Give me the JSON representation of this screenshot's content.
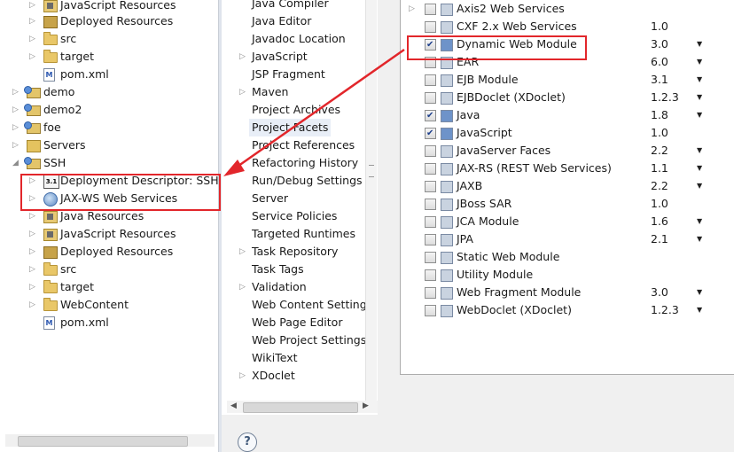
{
  "project_tree": {
    "items": [
      {
        "label": "JavaScript Resources",
        "icon": "js-resources-icon"
      },
      {
        "label": "Deployed Resources",
        "icon": "deployed-resources-icon"
      },
      {
        "label": "src",
        "icon": "folder-icon"
      },
      {
        "label": "target",
        "icon": "folder-icon"
      },
      {
        "label": "pom.xml",
        "icon": "maven-file-icon"
      },
      {
        "label": "demo",
        "icon": "project-icon"
      },
      {
        "label": "demo2",
        "icon": "project-icon"
      },
      {
        "label": "foe",
        "icon": "project-icon"
      },
      {
        "label": "Servers",
        "icon": "servers-folder-icon"
      },
      {
        "label": "SSH",
        "icon": "project-icon"
      },
      {
        "label": "Deployment Descriptor: SSH",
        "icon": "deployment-descriptor-icon"
      },
      {
        "label": "JAX-WS Web Services",
        "icon": "web-services-icon"
      },
      {
        "label": "Java Resources",
        "icon": "java-resources-icon"
      },
      {
        "label": "JavaScript Resources",
        "icon": "js-resources-icon"
      },
      {
        "label": "Deployed Resources",
        "icon": "deployed-resources-icon"
      },
      {
        "label": "src",
        "icon": "folder-icon"
      },
      {
        "label": "target",
        "icon": "folder-icon"
      },
      {
        "label": "WebContent",
        "icon": "folder-icon"
      },
      {
        "label": "pom.xml",
        "icon": "maven-file-icon"
      }
    ]
  },
  "properties_nav": {
    "items": [
      {
        "label": "Java Compiler"
      },
      {
        "label": "Java Editor"
      },
      {
        "label": "Javadoc Location"
      },
      {
        "label": "JavaScript"
      },
      {
        "label": "JSP Fragment"
      },
      {
        "label": "Maven"
      },
      {
        "label": "Project Archives"
      },
      {
        "label": "Project Facets"
      },
      {
        "label": "Project References"
      },
      {
        "label": "Refactoring History"
      },
      {
        "label": "Run/Debug Settings"
      },
      {
        "label": "Server"
      },
      {
        "label": "Service Policies"
      },
      {
        "label": "Targeted Runtimes"
      },
      {
        "label": "Task Repository"
      },
      {
        "label": "Task Tags"
      },
      {
        "label": "Validation"
      },
      {
        "label": "Web Content Settings"
      },
      {
        "label": "Web Page Editor"
      },
      {
        "label": "Web Project Settings"
      },
      {
        "label": "WikiText"
      },
      {
        "label": "XDoclet"
      }
    ],
    "selected": "Project Facets"
  },
  "facets": {
    "rows": [
      {
        "name": "Axis2 Web Services",
        "version": "",
        "checked": false,
        "has_dropdown": false
      },
      {
        "name": "CXF 2.x Web Services",
        "version": "1.0",
        "checked": false,
        "has_dropdown": false
      },
      {
        "name": "Dynamic Web Module",
        "version": "3.0",
        "checked": true,
        "has_dropdown": true
      },
      {
        "name": "EAR",
        "version": "6.0",
        "checked": false,
        "has_dropdown": true
      },
      {
        "name": "EJB Module",
        "version": "3.1",
        "checked": false,
        "has_dropdown": true
      },
      {
        "name": "EJBDoclet (XDoclet)",
        "version": "1.2.3",
        "checked": false,
        "has_dropdown": true
      },
      {
        "name": "Java",
        "version": "1.8",
        "checked": true,
        "has_dropdown": true
      },
      {
        "name": "JavaScript",
        "version": "1.0",
        "checked": true,
        "has_dropdown": false
      },
      {
        "name": "JavaServer Faces",
        "version": "2.2",
        "checked": false,
        "has_dropdown": true
      },
      {
        "name": "JAX-RS (REST Web Services)",
        "version": "1.1",
        "checked": false,
        "has_dropdown": true
      },
      {
        "name": "JAXB",
        "version": "2.2",
        "checked": false,
        "has_dropdown": true
      },
      {
        "name": "JBoss SAR",
        "version": "1.0",
        "checked": false,
        "has_dropdown": false
      },
      {
        "name": "JCA Module",
        "version": "1.6",
        "checked": false,
        "has_dropdown": true
      },
      {
        "name": "JPA",
        "version": "2.1",
        "checked": false,
        "has_dropdown": true
      },
      {
        "name": "Static Web Module",
        "version": "",
        "checked": false,
        "has_dropdown": false
      },
      {
        "name": "Utility Module",
        "version": "",
        "checked": false,
        "has_dropdown": false
      },
      {
        "name": "Web Fragment Module",
        "version": "3.0",
        "checked": false,
        "has_dropdown": true
      },
      {
        "name": "WebDoclet (XDoclet)",
        "version": "1.2.3",
        "checked": false,
        "has_dropdown": true
      }
    ]
  },
  "help": {
    "label": "?"
  },
  "colors": {
    "annotation_red": "#e2262b",
    "selection_bg": "#e8eef7"
  }
}
